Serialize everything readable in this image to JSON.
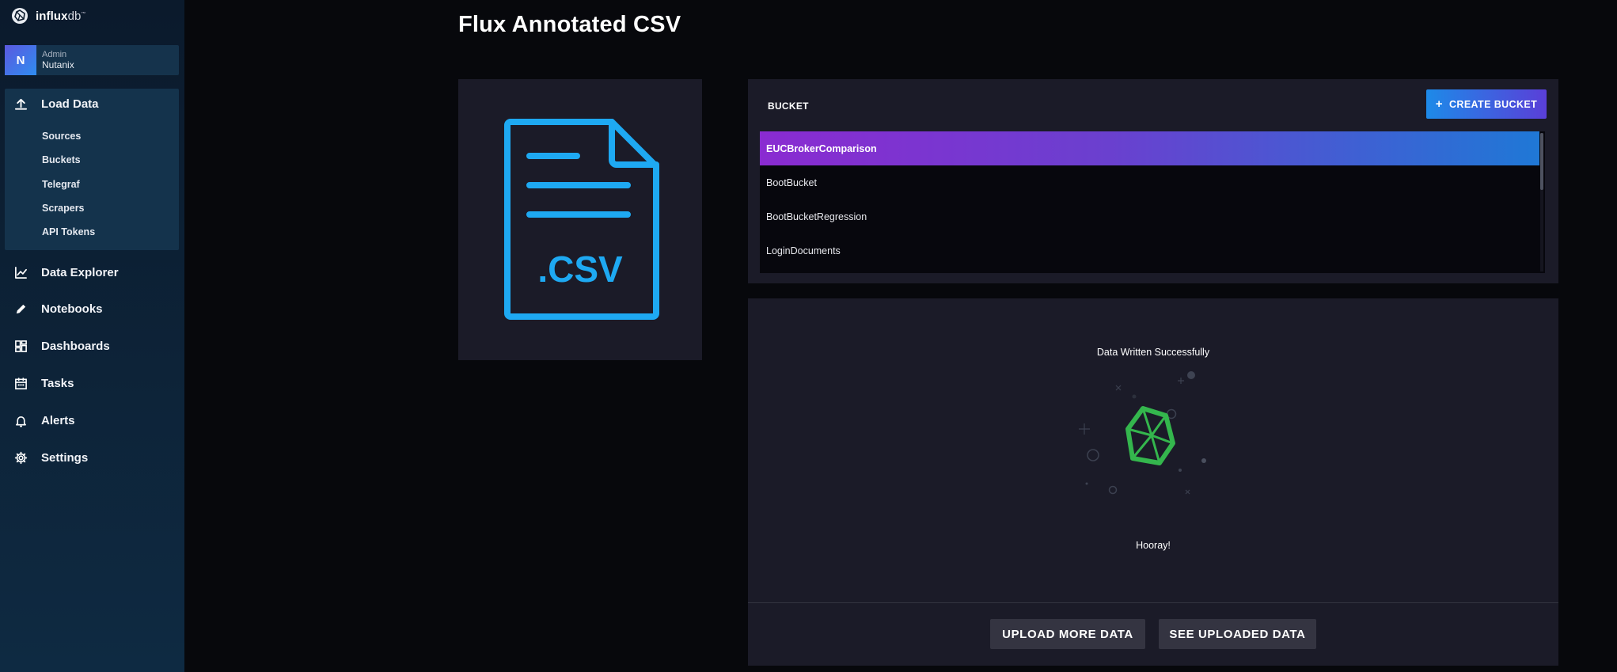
{
  "brand": {
    "name_bold": "influx",
    "name_light": "db",
    "tm": "™"
  },
  "org": {
    "avatar_letter": "N",
    "role": "Admin",
    "name": "Nutanix"
  },
  "nav": {
    "load_data": "Load Data",
    "sub_items": [
      "Sources",
      "Buckets",
      "Telegraf",
      "Scrapers",
      "API Tokens"
    ],
    "data_explorer": "Data Explorer",
    "notebooks": "Notebooks",
    "dashboards": "Dashboards",
    "tasks": "Tasks",
    "alerts": "Alerts",
    "settings": "Settings"
  },
  "page": {
    "title": "Flux Annotated CSV"
  },
  "file_card": {
    "extension": ".CSV",
    "accent": "#1ea9f2"
  },
  "bucket": {
    "label": "BUCKET",
    "create_label": "CREATE BUCKET",
    "items": [
      "EUCBrokerComparison",
      "BootBucket",
      "BootBucketRegression",
      "LoginDocuments"
    ],
    "selected": "EUCBrokerComparison"
  },
  "result": {
    "title": "Data Written Successfully",
    "message": "Hooray!",
    "success_color": "#34b64d"
  },
  "actions": {
    "upload_more": "UPLOAD MORE DATA",
    "see_uploaded": "SEE UPLOADED DATA"
  }
}
